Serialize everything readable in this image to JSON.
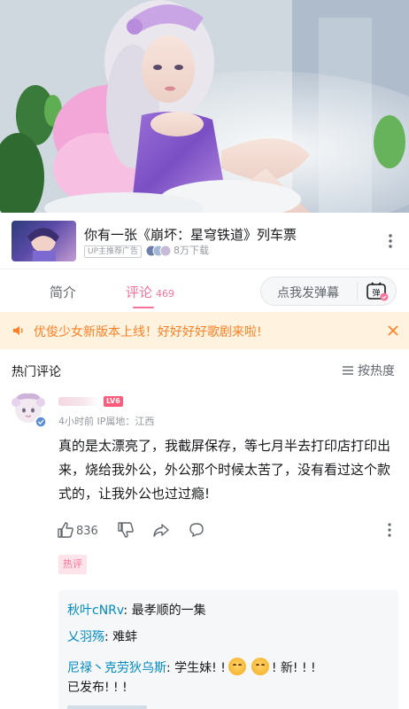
{
  "ad": {
    "title": "你有一张《崩坏：星穹铁道》列车票",
    "tag": "UP主推荐广告",
    "downloads": "8万下载"
  },
  "tabs": {
    "intro": "简介",
    "comments": "评论",
    "comment_count": "469",
    "danmaku_placeholder": "点我发弹幕",
    "danmaku_icon_label": "弹"
  },
  "notice": {
    "text": "优俊少女新版本上线！好好好好歌剧来啦!"
  },
  "hot": {
    "title": "热门评论",
    "sort_label": "按热度"
  },
  "comment": {
    "level": "LV6",
    "meta": "4小时前  IP属地：江西",
    "body": "真的是太漂亮了，我截屏保存，等七月半去打印店打印出来，烧给我外公，外公那个时候太苦了，没有看过这个款式的，让我外公也过过瘾!",
    "likes": "836",
    "tag": "热评"
  },
  "replies": [
    {
      "name": "秋叶cNRv",
      "sep": ": ",
      "text": "最孝顺的一集"
    },
    {
      "name": "乂羽殇",
      "sep": ": ",
      "text": "难蚌"
    },
    {
      "name": "尼禄丶克劳狄乌斯",
      "sep": ": ",
      "text_a": "学生妹!  !",
      "text_b": "!  新!  !  !",
      "text_c": "已发布!  !  !"
    }
  ],
  "colors": {
    "accent": "#fb7299",
    "notice_text": "#ff7f24",
    "notice_bg": "#fff3e0",
    "reply_name": "#008ac5"
  }
}
